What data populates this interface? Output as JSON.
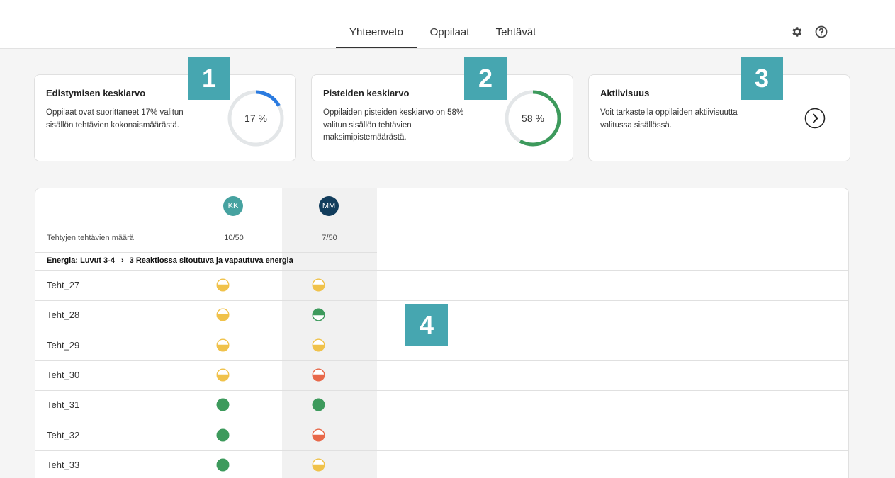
{
  "nav": {
    "tabs": [
      "Yhteenveto",
      "Oppilaat",
      "Tehtävät"
    ],
    "active_tab": "Yhteenveto",
    "icons": [
      "gear-icon",
      "help-icon"
    ]
  },
  "cards": [
    {
      "title": "Edistymisen keskiarvo",
      "description": "Oppilaat ovat suorittaneet 17% valitun sisällön tehtävien kokonaismäärästä.",
      "value_label": "17 %",
      "progress": 0.17,
      "ring_color": "#2b7be0"
    },
    {
      "title": "Pisteiden keskiarvo",
      "description": "Oppilaiden pisteiden keskiarvo on 58% valitun sisällön tehtävien maksimipistemäärästä.",
      "value_label": "58 %",
      "progress": 0.58,
      "ring_color": "#3d9a5c"
    },
    {
      "title": "Aktiivisuus",
      "description": "Voit tarkastella oppilaiden aktiivisuutta valitussa sisällössä.",
      "icon": "chevron-right-circle-icon"
    }
  ],
  "badges": [
    "1",
    "2",
    "3",
    "4"
  ],
  "table": {
    "students": [
      {
        "initials": "KK",
        "color": "#46a2a0",
        "completed": "10/50"
      },
      {
        "initials": "MM",
        "color": "#123d5c",
        "completed": "7/50"
      }
    ],
    "completed_label": "Tehtyjen tehtävien määrä",
    "breadcrumb": {
      "section": "Energia: Luvut 3-4",
      "subsection": "3 Reaktiossa sitoutuva ja vapautuva energia"
    },
    "rows": [
      {
        "label": "Teht_27",
        "status": [
          "half-yellow",
          "half-yellow"
        ]
      },
      {
        "label": "Teht_28",
        "status": [
          "half-yellow",
          "half-green"
        ]
      },
      {
        "label": "Teht_29",
        "status": [
          "half-yellow",
          "half-yellow"
        ]
      },
      {
        "label": "Teht_30",
        "status": [
          "half-yellow",
          "half-red"
        ]
      },
      {
        "label": "Teht_31",
        "status": [
          "full-green",
          "full-green"
        ]
      },
      {
        "label": "Teht_32",
        "status": [
          "full-green",
          "half-red"
        ]
      },
      {
        "label": "Teht_33",
        "status": [
          "full-green",
          "half-yellow"
        ]
      }
    ],
    "status_colors": {
      "yellow": "#f0c24b",
      "green": "#3d9a5c",
      "red": "#e8694a"
    }
  }
}
